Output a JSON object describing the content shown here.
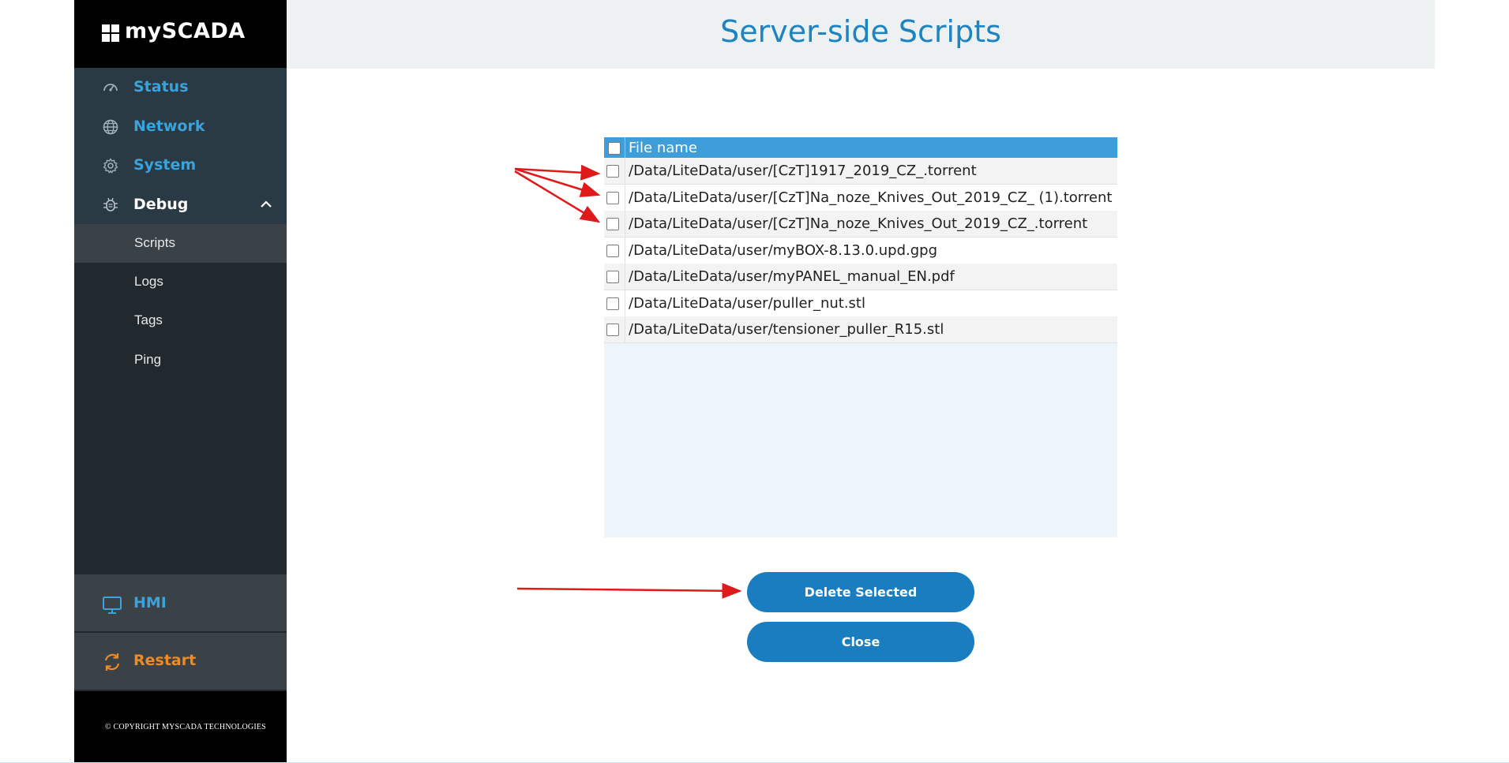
{
  "sidebar": {
    "brand": "mySCADA",
    "nav": [
      {
        "label": "Status",
        "icon": "gauge-icon"
      },
      {
        "label": "Network",
        "icon": "globe-icon"
      },
      {
        "label": "System",
        "icon": "gear-icon"
      },
      {
        "label": "Debug",
        "icon": "bug-icon",
        "expanded": true
      }
    ],
    "debug_items": [
      {
        "label": "Scripts",
        "active": true
      },
      {
        "label": "Logs"
      },
      {
        "label": "Tags"
      },
      {
        "label": "Ping"
      }
    ],
    "hmi": {
      "label": "HMI",
      "icon": "monitor-icon"
    },
    "restart": {
      "label": "Restart",
      "icon": "refresh-icon"
    },
    "copyright": "© COPYRIGHT MYSCADA TECHNOLOGIES"
  },
  "header": {
    "title": "Server-side Scripts"
  },
  "files": {
    "column_header": "File name",
    "rows": [
      "/Data/LiteData/user/[CzT]1917_2019_CZ_.torrent",
      "/Data/LiteData/user/[CzT]Na_noze_Knives_Out_2019_CZ_ (1).torrent",
      "/Data/LiteData/user/[CzT]Na_noze_Knives_Out_2019_CZ_.torrent",
      "/Data/LiteData/user/myBOX-8.13.0.upd.gpg",
      "/Data/LiteData/user/myPANEL_manual_EN.pdf",
      "/Data/LiteData/user/puller_nut.stl",
      "/Data/LiteData/user/tensioner_puller_R15.stl"
    ]
  },
  "actions": {
    "delete_label": "Delete Selected",
    "close_label": "Close"
  },
  "colors": {
    "accent": "#1a7dc0",
    "nav_link": "#3aa3dc",
    "restart": "#f08a24",
    "annotation": "#e0191b"
  }
}
